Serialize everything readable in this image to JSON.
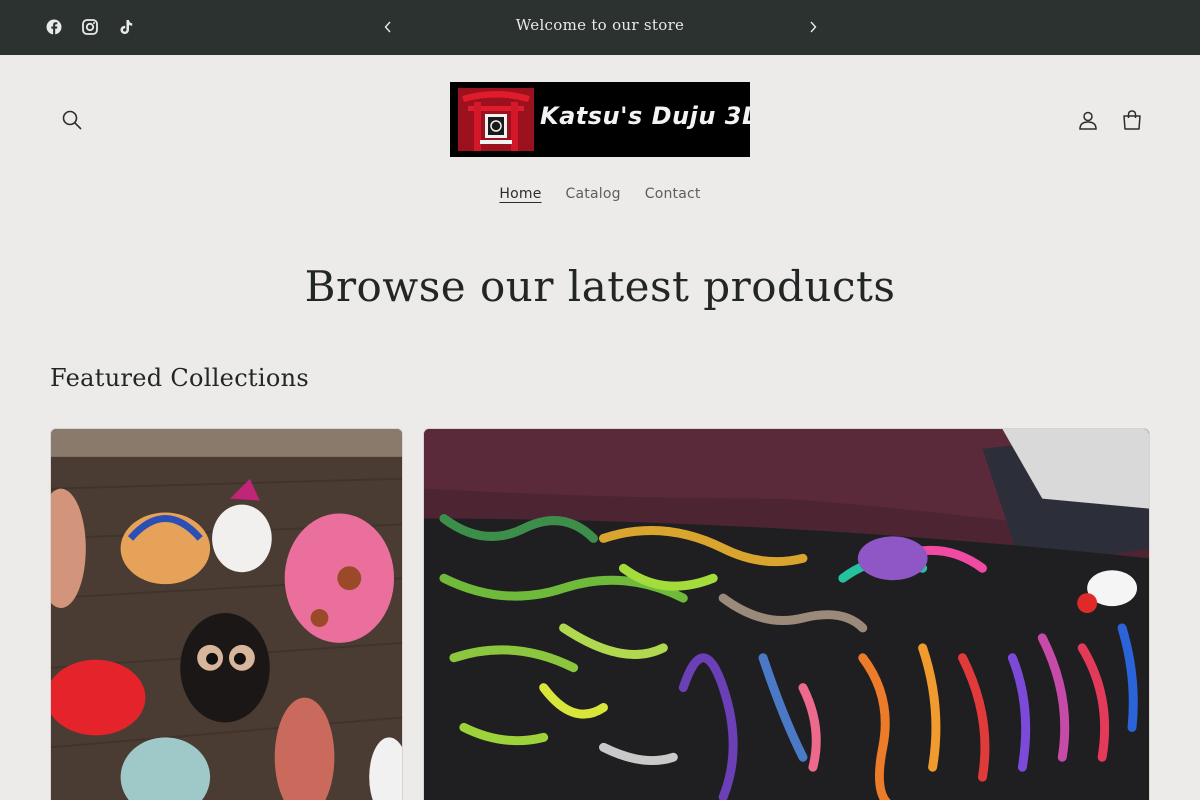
{
  "announcement": {
    "text": "Welcome to our store",
    "prev_icon": "chevron-left-icon",
    "next_icon": "chevron-right-icon",
    "background": "#2c322f"
  },
  "social": [
    "facebook-icon",
    "instagram-icon",
    "tiktok-icon"
  ],
  "header": {
    "logo_text": "Katsu's Duju 3D",
    "icons": [
      "search-icon",
      "account-icon",
      "cart-icon"
    ]
  },
  "nav": {
    "home": "Home",
    "catalog": "Catalog",
    "contact": "Contact"
  },
  "hero": {
    "title": "Browse our latest products"
  },
  "featured": {
    "title": "Featured Collections"
  },
  "colors": {
    "page_background": "#edebe9",
    "text": "#222624"
  }
}
